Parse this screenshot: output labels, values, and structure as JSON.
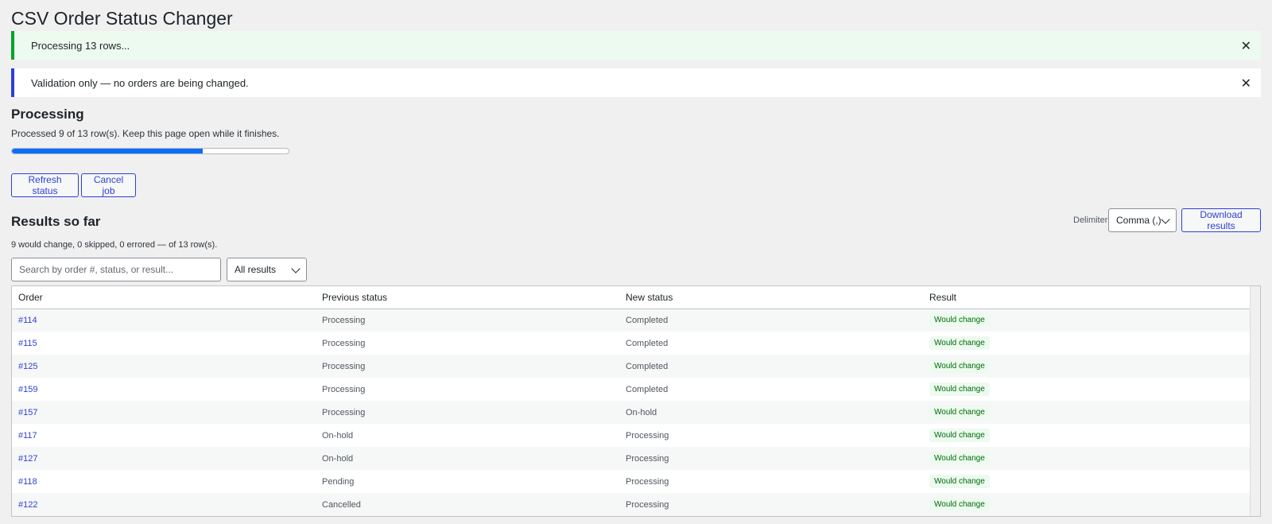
{
  "page": {
    "title": "CSV Order Status Changer"
  },
  "notices": {
    "processing": "Processing 13 rows...",
    "validation": "Validation only — no orders are being changed.",
    "dismiss_glyph": "✕"
  },
  "processing": {
    "heading": "Processing",
    "progress_text": "Processed 9 of 13 row(s). Keep this page open while it finishes.",
    "progress_percent": 69,
    "progress_color": "#0b6dfb"
  },
  "actions": {
    "refresh_label": "Refresh status",
    "cancel_label": "Cancel job"
  },
  "results": {
    "heading": "Results so far",
    "delimiter_label": "Delimiter:",
    "delimiter_value": "Comma (,)",
    "download_label": "Download results",
    "summary": "9 would change, 0 skipped, 0 errored — of 13 row(s).",
    "search_placeholder": "Search by order #, status, or result...",
    "filter_value": "All results",
    "columns": [
      "Order",
      "Previous status",
      "New status",
      "Result"
    ],
    "rows": [
      {
        "order": "#114",
        "previous": "Processing",
        "new": "Completed",
        "result": "Would change"
      },
      {
        "order": "#115",
        "previous": "Processing",
        "new": "Completed",
        "result": "Would change"
      },
      {
        "order": "#125",
        "previous": "Processing",
        "new": "Completed",
        "result": "Would change"
      },
      {
        "order": "#159",
        "previous": "Processing",
        "new": "Completed",
        "result": "Would change"
      },
      {
        "order": "#157",
        "previous": "Processing",
        "new": "On-hold",
        "result": "Would change"
      },
      {
        "order": "#117",
        "previous": "On-hold",
        "new": "Processing",
        "result": "Would change"
      },
      {
        "order": "#127",
        "previous": "On-hold",
        "new": "Processing",
        "result": "Would change"
      },
      {
        "order": "#118",
        "previous": "Pending",
        "new": "Processing",
        "result": "Would change"
      },
      {
        "order": "#122",
        "previous": "Cancelled",
        "new": "Processing",
        "result": "Would change"
      }
    ]
  }
}
